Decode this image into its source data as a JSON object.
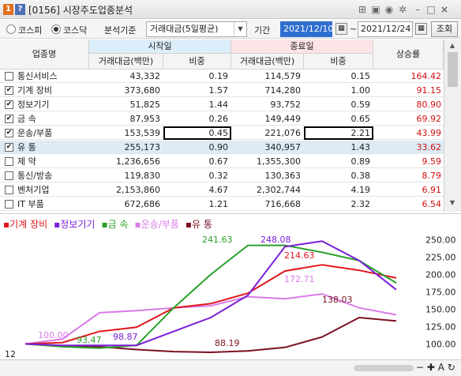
{
  "window": {
    "num1": "1",
    "num2": "?",
    "title": "[0156] 시장주도업종분석"
  },
  "toolbar": {
    "market_kospi": "코스피",
    "market_kosdaq": "코스닥",
    "criteria_label": "분석기준",
    "criteria_value": "거래대금(5일평균)",
    "period_label": "기간",
    "start_date": "2021/12/10",
    "tilde": "~",
    "end_date": "2021/12/24",
    "query_button": "조회"
  },
  "table": {
    "headers": {
      "sector": "업종명",
      "start_day": "시작일",
      "end_day": "종료일",
      "amount": "거래대금(백만)",
      "ratio": "비중",
      "rise_rate": "상승률"
    },
    "rows": [
      {
        "name": "통신서비스",
        "checked": false,
        "start_amount": "43,332",
        "start_ratio": "0.19",
        "end_amount": "114,579",
        "end_ratio": "0.15",
        "rise": "164.42"
      },
      {
        "name": "기계 장비",
        "checked": true,
        "start_amount": "373,680",
        "start_ratio": "1.57",
        "end_amount": "714,280",
        "end_ratio": "1.00",
        "rise": "91.15"
      },
      {
        "name": "정보기기",
        "checked": true,
        "start_amount": "51,825",
        "start_ratio": "1.44",
        "end_amount": "93,752",
        "end_ratio": "0.59",
        "rise": "80.90"
      },
      {
        "name": "금    속",
        "checked": true,
        "start_amount": "87,953",
        "start_ratio": "0.26",
        "end_amount": "149,449",
        "end_ratio": "0.65",
        "rise": "69.92"
      },
      {
        "name": "운송/부품",
        "checked": true,
        "start_amount": "153,539",
        "start_ratio": "0.45",
        "end_amount": "221,076",
        "end_ratio": "2.21",
        "rise": "43.99"
      },
      {
        "name": "유    통",
        "checked": true,
        "start_amount": "255,173",
        "start_ratio": "0.90",
        "end_amount": "340,957",
        "end_ratio": "1.43",
        "rise": "33.62"
      },
      {
        "name": "제    약",
        "checked": false,
        "start_amount": "1,236,656",
        "start_ratio": "0.67",
        "end_amount": "1,355,300",
        "end_ratio": "0.89",
        "rise": "9.59"
      },
      {
        "name": "통신/방송",
        "checked": false,
        "start_amount": "119,830",
        "start_ratio": "0.32",
        "end_amount": "130,363",
        "end_ratio": "0.38",
        "rise": "8.79"
      },
      {
        "name": "벤처기업",
        "checked": false,
        "start_amount": "2,153,860",
        "start_ratio": "4.67",
        "end_amount": "2,302,744",
        "end_ratio": "4.19",
        "rise": "6.91"
      },
      {
        "name": "IT 부품",
        "checked": false,
        "start_amount": "672,686",
        "start_ratio": "1.21",
        "end_amount": "716,668",
        "end_ratio": "2.32",
        "rise": "6.54"
      }
    ]
  },
  "chart": {
    "legend": [
      {
        "label": "기계 장비",
        "color": "#e0181c"
      },
      {
        "label": "정보기기",
        "color": "#7a1fd6"
      },
      {
        "label": "금    속",
        "color": "#2aa02a"
      },
      {
        "label": "운송/부품",
        "color": "#d97be8"
      },
      {
        "label": "유    통",
        "color": "#7a1020"
      }
    ],
    "y_ticks": [
      "250.00",
      "225.00",
      "200.00",
      "175.00",
      "150.00",
      "125.00",
      "100.00"
    ],
    "annotations": [
      {
        "text": "241.63",
        "color": "#2aa02a"
      },
      {
        "text": "248.08",
        "color": "#7a1fd6"
      },
      {
        "text": "214.63",
        "color": "#e0181c"
      },
      {
        "text": "172.71",
        "color": "#d97be8"
      },
      {
        "text": "138.03",
        "color": "#7a1020"
      },
      {
        "text": "100.00",
        "color": "#d97be8"
      },
      {
        "text": "93.47",
        "color": "#2aa02a"
      },
      {
        "text": "98.87",
        "color": "#7a1fd6"
      },
      {
        "text": "88.19",
        "color": "#7a1020"
      }
    ],
    "series_values": {
      "machine": [
        100,
        102,
        118,
        124,
        152,
        158,
        173,
        205,
        214,
        206,
        195
      ],
      "info": [
        100,
        98,
        98,
        98,
        118,
        138,
        170,
        240,
        248,
        220,
        178
      ],
      "metal": [
        100,
        96,
        94,
        98,
        152,
        200,
        242,
        242,
        232,
        220,
        188
      ],
      "transport": [
        100,
        107,
        145,
        148,
        152,
        155,
        168,
        165,
        172,
        152,
        142
      ],
      "retail": [
        100,
        97,
        96,
        92,
        89,
        88,
        90,
        95,
        110,
        138,
        133
      ]
    },
    "x_label": "12"
  }
}
